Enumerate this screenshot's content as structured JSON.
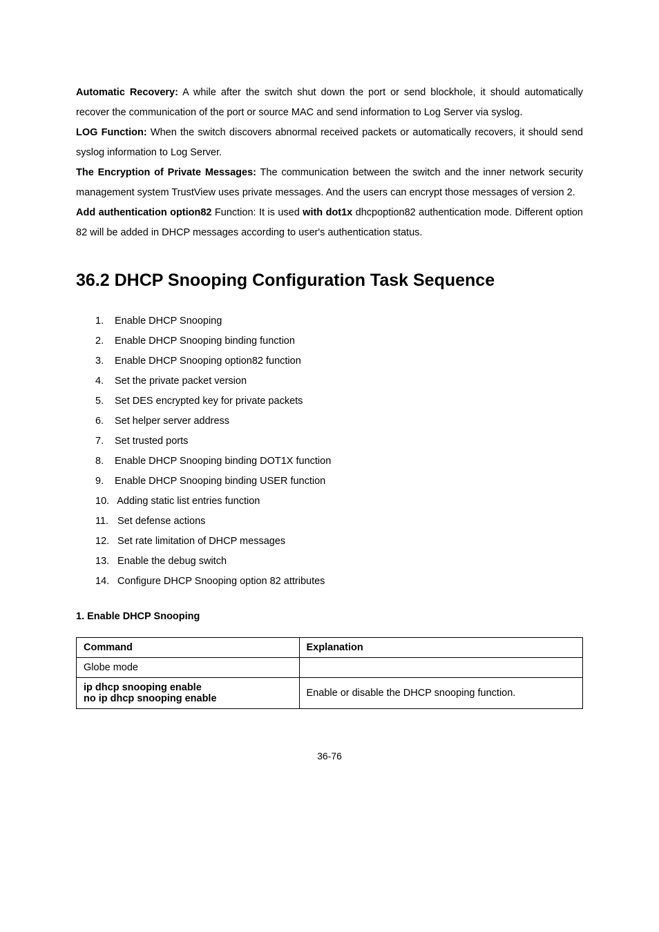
{
  "para1": {
    "b": "Automatic Recovery:",
    "t": " A while after the switch shut down the port or send blockhole, it should automatically recover the communication of the port or source MAC and send information to Log Server via syslog."
  },
  "para2": {
    "b": "LOG Function:",
    "t": " When the switch discovers abnormal received packets or automatically recovers, it should send syslog information to Log Server."
  },
  "para3": {
    "b": "The Encryption of Private Messages:",
    "t": " The communication between the switch and the inner network security management system TrustView uses private messages. And the users can encrypt those messages of version 2."
  },
  "para4": {
    "b1": "Add authentication option82",
    "t1": " Function: It is used ",
    "b2": "with dot1x",
    "t2": " dhcpoption82 authentication mode. Different option 82 will be added in DHCP messages according to user's authentication status."
  },
  "heading": "36.2 DHCP Snooping Configuration Task Sequence",
  "list": [
    {
      "n": "1.",
      "t": "Enable DHCP Snooping"
    },
    {
      "n": "2.",
      "t": "Enable DHCP Snooping binding function"
    },
    {
      "n": "3.",
      "t": "Enable DHCP Snooping option82 function"
    },
    {
      "n": "4.",
      "t": "Set the private packet version"
    },
    {
      "n": "5.",
      "t": "Set DES encrypted key for private packets"
    },
    {
      "n": "6.",
      "t": "Set helper server address"
    },
    {
      "n": "7.",
      "t": "Set trusted ports"
    },
    {
      "n": "8.",
      "t": "Enable DHCP Snooping binding DOT1X function"
    },
    {
      "n": "9.",
      "t": "Enable DHCP Snooping binding USER function"
    },
    {
      "n": "10.",
      "t": " Adding static list entries function"
    },
    {
      "n": "11.",
      "t": " Set defense actions"
    },
    {
      "n": "12.",
      "t": " Set rate limitation of DHCP messages"
    },
    {
      "n": "13.",
      "t": " Enable the debug switch"
    },
    {
      "n": "14.",
      "t": " Configure DHCP Snooping option 82 attributes"
    }
  ],
  "section_title": "1. Enable DHCP Snooping",
  "table": {
    "h1": "Command",
    "h2": "Explanation",
    "r1c1": "Globe mode",
    "r1c2": "",
    "r2c1a": "ip dhcp snooping enable",
    "r2c1b": "no ip dhcp snooping enable",
    "r2c2": "Enable or disable the DHCP snooping function."
  },
  "page_num": "36-76"
}
